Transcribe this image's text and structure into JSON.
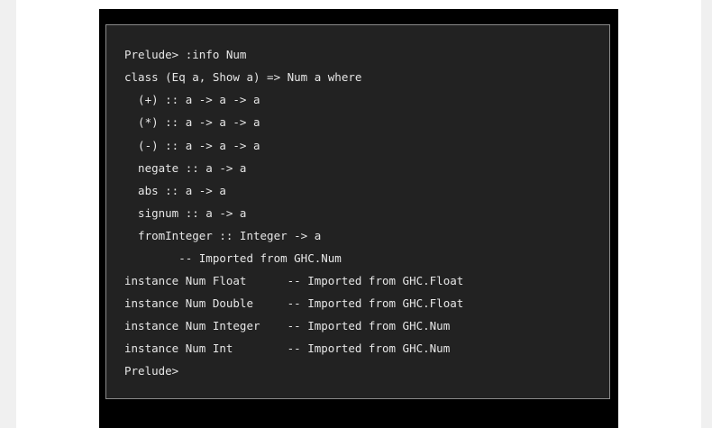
{
  "terminal": {
    "lines": [
      "Prelude> :info Num",
      "class (Eq a, Show a) => Num a where",
      "  (+) :: a -> a -> a",
      "  (*) :: a -> a -> a",
      "  (-) :: a -> a -> a",
      "  negate :: a -> a",
      "  abs :: a -> a",
      "  signum :: a -> a",
      "  fromInteger :: Integer -> a",
      "        -- Imported from GHC.Num",
      "instance Num Float      -- Imported from GHC.Float",
      "instance Num Double     -- Imported from GHC.Float",
      "instance Num Integer    -- Imported from GHC.Num",
      "instance Num Int        -- Imported from GHC.Num",
      "Prelude>"
    ]
  }
}
